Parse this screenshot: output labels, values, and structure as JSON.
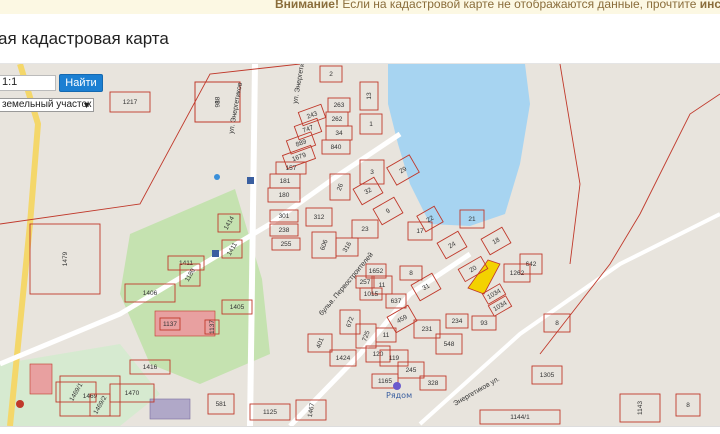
{
  "notice": {
    "prefix": "Внимание!",
    "text": " Если на кадастровой карте не отображаются данные, прочтите ",
    "link": "инструкцию"
  },
  "header": {
    "title": "ая кадастровая карта"
  },
  "search": {
    "value": "1:1",
    "button_label": "Найти"
  },
  "object_type": {
    "selected": "земельный участок"
  },
  "map": {
    "colors": {
      "background": "#e8e4dd",
      "parcel_border": "#c0392b",
      "lake": "#a7d4f1",
      "highlight": "#f3d200",
      "greenery": "#c5e2b0"
    },
    "streets": [
      "ул. Энергетиков",
      "ул. Энергетиков",
      "бульв. Первостроителей",
      "Энергетиков ул."
    ],
    "parcels": [
      "988",
      "1217",
      "2",
      "263",
      "262",
      "243",
      "747",
      "34",
      "889",
      "840",
      "1679",
      "1",
      "157",
      "181",
      "180",
      "301",
      "238",
      "255",
      "312",
      "606",
      "316",
      "23",
      "3",
      "32",
      "26",
      "29",
      "1479",
      "1411",
      "1414",
      "1411",
      "1180",
      "1406",
      "1405",
      "1137",
      "1137",
      "9",
      "17",
      "22",
      "24",
      "20",
      "18",
      "642",
      "1262",
      "1034",
      "1034",
      "1652",
      "8",
      "11",
      "257",
      "1015",
      "637",
      "31",
      "459",
      "11",
      "672",
      "401",
      "725",
      "120",
      "1424",
      "119",
      "231",
      "234",
      "93",
      "1469",
      "548",
      "245",
      "328",
      "1165",
      "581",
      "1416",
      "1470",
      "1469/1",
      "1469/2",
      "1143",
      "1144/1",
      "1125",
      "1467",
      "13",
      "21",
      "8",
      "1305",
      "8",
      "1"
    ],
    "poi_label": "Рядом",
    "highlighted_parcel": "1"
  }
}
